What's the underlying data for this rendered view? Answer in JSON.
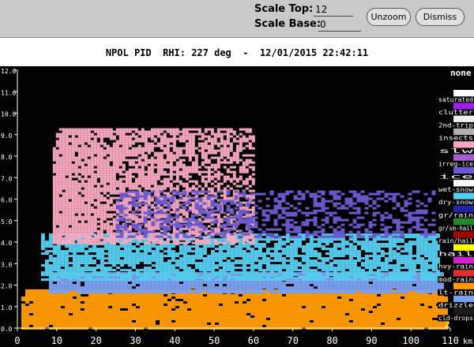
{
  "toolbar": {
    "scale_top_label": "Scale Top:",
    "scale_top_value": "12",
    "scale_base_label": "Scale Base:",
    "scale_base_value": "0",
    "unzoom_label": "Unzoom",
    "dismiss_label": "Dismiss"
  },
  "plot_title": "NPOL PID  RHI: 227 deg  -  12/01/2015 22:42:11",
  "chart_data": {
    "type": "heatmap",
    "title": "NPOL PID  RHI: 227 deg  -  12/01/2015 22:42:11",
    "xlabel": "km",
    "ylabel": "",
    "xlim": [
      0,
      110
    ],
    "ylim": [
      0,
      12
    ],
    "x_ticks": [
      "0",
      "10",
      "20",
      "30",
      "40",
      "50",
      "60",
      "70",
      "80",
      "90",
      "100",
      "110"
    ],
    "y_ticks": [
      "0.0",
      "1.0",
      "2.0",
      "3.0",
      "4.0",
      "5.0",
      "6.0",
      "7.0",
      "8.0",
      "9.0",
      "10.0",
      "11.0",
      "12.0"
    ],
    "corner_value": "2",
    "legend_header": "none",
    "legend": [
      {
        "label": "saturated",
        "color": "#ffffff"
      },
      {
        "label": "clutter",
        "color": "#a020f0"
      },
      {
        "label": "2nd-trip",
        "color": "#f0f0f0"
      },
      {
        "label": "insects",
        "color": "#b0b0b0"
      },
      {
        "label": "slw",
        "color": "#f7a8c0"
      },
      {
        "label": "irreg-ice",
        "color": "#a85ad0"
      },
      {
        "label": "ice",
        "color": "#6a5acd"
      },
      {
        "label": "wet-snow",
        "color": "#ffffff"
      },
      {
        "label": "dry-snow",
        "color": "#55ccee"
      },
      {
        "label": "gr/rain",
        "color": "#2222aa"
      },
      {
        "label": "gr/sm-hail",
        "color": "#1e8c2e"
      },
      {
        "label": "rain/hail",
        "color": "#a00000"
      },
      {
        "label": "hail",
        "color": "#ffff00"
      },
      {
        "label": "hvy-rain",
        "color": "#d020d0"
      },
      {
        "label": "mod-rain",
        "color": "#e03030"
      },
      {
        "label": "lt-rain",
        "color": "#ff9900"
      },
      {
        "label": "drizzle",
        "color": "#7ca0f0"
      },
      {
        "label": "cld-drops",
        "color": "#1c1c1c"
      }
    ],
    "layers": [
      {
        "class": "lt-rain",
        "base_km": 0.0,
        "top_km": 1.8,
        "x_from": 1,
        "x_to": 109
      },
      {
        "class": "drizzle",
        "base_km": 1.7,
        "top_km": 2.6,
        "x_from": 8,
        "x_to": 108
      },
      {
        "class": "dry-snow",
        "base_km": 2.2,
        "top_km": 4.4,
        "x_from": 6,
        "x_to": 107
      },
      {
        "class": "slw",
        "base_km": 4.0,
        "top_km": 9.3,
        "x_from": 9,
        "x_to": 60
      },
      {
        "class": "ice",
        "base_km": 4.2,
        "top_km": 6.4,
        "x_from": 25,
        "x_to": 106
      }
    ]
  }
}
